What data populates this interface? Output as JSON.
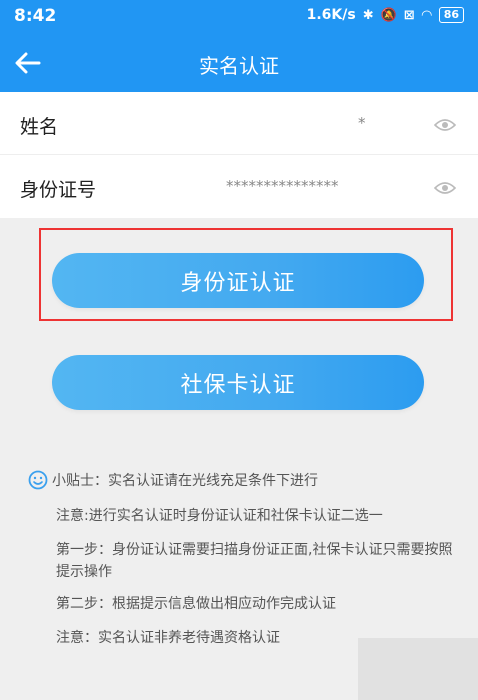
{
  "status": {
    "time": "8:42",
    "network_speed": "1.6K/s",
    "battery": "86"
  },
  "nav": {
    "title": "实名认证"
  },
  "form": {
    "name_label": "姓名",
    "name_value": "*",
    "id_label": "身份证号",
    "id_value": "***************"
  },
  "buttons": {
    "id_card_auth": "身份证认证",
    "social_card_auth": "社保卡认证"
  },
  "tips": {
    "header": "小贴士：实名认证请在光线充足条件下进行",
    "items": [
      "注意:进行实名认证时身份证认证和社保卡认证二选一",
      "第一步：身份证认证需要扫描身份证正面,社保卡认证只需要按照提示操作",
      "第二步：根据提示信息做出相应动作完成认证",
      "注意：实名认证非养老待遇资格认证"
    ]
  },
  "colors": {
    "primary": "#2196f3",
    "button_start": "#53b6f2",
    "button_end": "#2c9cf0",
    "highlight": "#ee3333"
  },
  "icons": {
    "back": "arrow-left-icon",
    "eye": "eye-icon",
    "smiley": "smiley-icon"
  }
}
